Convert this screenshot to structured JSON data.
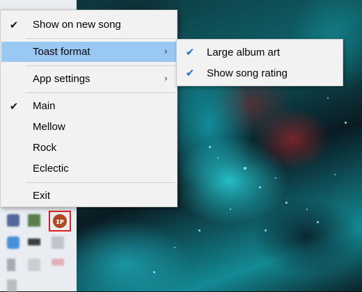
{
  "context_menu": {
    "items": [
      {
        "label": "Show on new song",
        "checked": true,
        "has_submenu": false
      },
      {
        "label": "Toast format",
        "checked": false,
        "has_submenu": true,
        "highlighted": true
      },
      {
        "label": "App settings",
        "checked": false,
        "has_submenu": true
      },
      {
        "label": "Main",
        "checked": true,
        "has_submenu": false
      },
      {
        "label": "Mellow",
        "checked": false,
        "has_submenu": false
      },
      {
        "label": "Rock",
        "checked": false,
        "has_submenu": false
      },
      {
        "label": "Eclectic",
        "checked": false,
        "has_submenu": false
      },
      {
        "label": "Exit",
        "checked": false,
        "has_submenu": false
      }
    ],
    "check_glyph": "✔",
    "submenu_arrow_glyph": "›"
  },
  "toast_format_submenu": {
    "items": [
      {
        "label": "Large album art",
        "checked": true
      },
      {
        "label": "Show song rating",
        "checked": true
      }
    ]
  },
  "tray": {
    "app_icon_glyph": "ɪᴘ"
  },
  "colors": {
    "menu_background": "#f2f2f2",
    "highlight": "#99c9f3",
    "selected_icon_border": "#e02020"
  }
}
